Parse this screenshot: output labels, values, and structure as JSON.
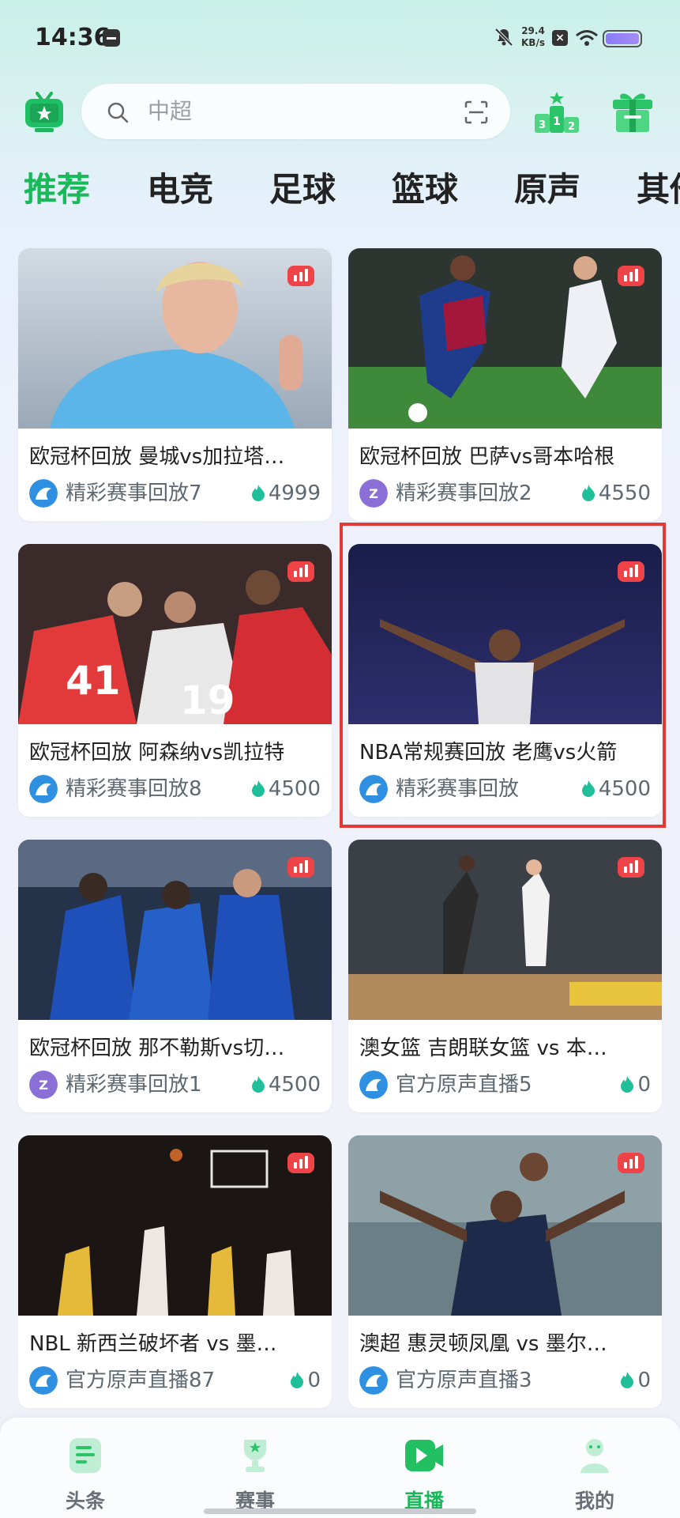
{
  "status_bar": {
    "time": "14:36",
    "net_speed": "29.4",
    "net_unit": "KB/s",
    "battery_color": "#9a86f5"
  },
  "search": {
    "placeholder": "中超"
  },
  "tabs": [
    {
      "label": "推荐",
      "active": true
    },
    {
      "label": "电竞"
    },
    {
      "label": "足球"
    },
    {
      "label": "篮球"
    },
    {
      "label": "原声"
    },
    {
      "label": "其他"
    }
  ],
  "cards": [
    {
      "title": "欧冠杯回放 曼城vs加拉塔…",
      "channel": "精彩赛事回放7",
      "heat": "4999"
    },
    {
      "title": "欧冠杯回放  巴萨vs哥本哈根",
      "channel": "精彩赛事回放2",
      "heat": "4550"
    },
    {
      "title": "欧冠杯回放   阿森纳vs凯拉特",
      "channel": "精彩赛事回放8",
      "heat": "4500"
    },
    {
      "title": "NBA常规赛回放  老鹰vs火箭",
      "channel": "精彩赛事回放",
      "heat": "4500"
    },
    {
      "title": "欧冠杯回放 那不勒斯vs切…",
      "channel": "精彩赛事回放1",
      "heat": "4500"
    },
    {
      "title": "澳女篮  吉朗联女篮 vs 本…",
      "channel": "官方原声直播5",
      "heat": "0"
    },
    {
      "title": "NBL  新西兰破坏者 vs 墨…",
      "channel": "官方原声直播87",
      "heat": "0"
    },
    {
      "title": "澳超  惠灵顿凤凰 vs 墨尔…",
      "channel": "官方原声直播3",
      "heat": "0"
    }
  ],
  "bottom_nav": [
    {
      "label": "头条",
      "icon": "headline-icon"
    },
    {
      "label": "赛事",
      "icon": "trophy-icon"
    },
    {
      "label": "直播",
      "icon": "live-play-icon",
      "active": true
    },
    {
      "label": "我的",
      "icon": "profile-icon"
    }
  ],
  "colors": {
    "accent": "#19b95a",
    "live_badge": "#ee4448",
    "highlight": "#e53935"
  }
}
